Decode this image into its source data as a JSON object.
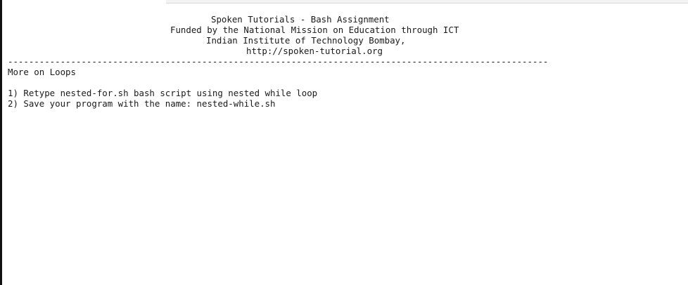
{
  "header": {
    "title": "Spoken Tutorials - Bash Assignment",
    "funding": "Funded by the National Mission on Education through ICT",
    "institute": "Indian Institute of Technology Bombay,",
    "url": "http://spoken-tutorial.org"
  },
  "separator": "-------------------------------------------------------------------------------------------------------",
  "section": {
    "title": "More on Loops"
  },
  "tasks": [
    "1) Retype nested-for.sh bash script using nested while loop",
    "2) Save your program with the name: nested-while.sh"
  ]
}
